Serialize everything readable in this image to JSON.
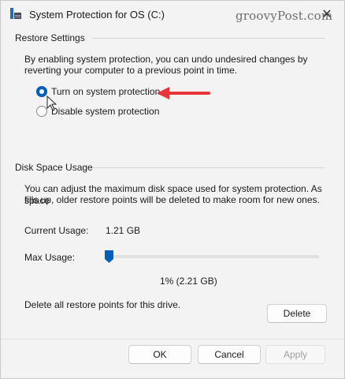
{
  "window": {
    "title": "System Protection for OS (C:)",
    "watermark": "groovyPost.com",
    "close_glyph": "✕",
    "icon": "system-icon"
  },
  "restore_settings": {
    "group_label": "Restore Settings",
    "description_line1": "By enabling system protection, you can undo undesired changes by",
    "description_line2": "reverting your computer to a previous point in time.",
    "options": [
      {
        "label": "Turn on system protection",
        "selected": true
      },
      {
        "label": "Disable system protection",
        "selected": false
      }
    ],
    "accent_color": "#005fb8",
    "annotation_arrow_color": "#e8363a"
  },
  "disk_space": {
    "group_label": "Disk Space Usage",
    "description_line1": "You can adjust the maximum disk space used for system protection. As space",
    "description_line2": "fills up, older restore points will be deleted to make room for new ones.",
    "current_usage_label": "Current Usage:",
    "current_usage_value": "1.21 GB",
    "max_usage_label": "Max Usage:",
    "max_usage_percent": 1,
    "max_usage_value": "1% (2.21 GB)",
    "delete_text": "Delete all restore points for this drive.",
    "delete_button": "Delete"
  },
  "footer": {
    "ok": "OK",
    "cancel": "Cancel",
    "apply": "Apply"
  }
}
